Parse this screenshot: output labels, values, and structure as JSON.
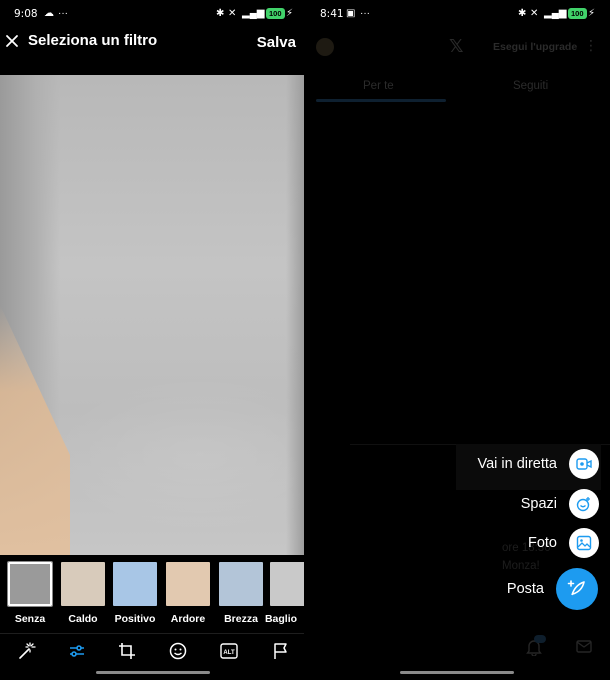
{
  "left": {
    "status": {
      "time": "9:08",
      "battery": "100"
    },
    "header": {
      "title": "Seleziona un filtro",
      "save_label": "Salva"
    },
    "filters": [
      {
        "label": "Senza",
        "selected": true,
        "color": "#9a9a9a"
      },
      {
        "label": "Caldo",
        "selected": false,
        "color": "#d8cbbb"
      },
      {
        "label": "Positivo",
        "selected": false,
        "color": "#a8c6e6"
      },
      {
        "label": "Ardore",
        "selected": false,
        "color": "#e2c9b0"
      },
      {
        "label": "Brezza",
        "selected": false,
        "color": "#b3c5d8"
      },
      {
        "label": "Baglio",
        "selected": false,
        "color": "#c9c9c9"
      }
    ],
    "toolbar": [
      {
        "icon": "magic-wand-icon"
      },
      {
        "icon": "sliders-icon",
        "active": true,
        "color": "#1d9bf0"
      },
      {
        "icon": "crop-icon"
      },
      {
        "icon": "sticker-icon"
      },
      {
        "icon": "alt-text-icon",
        "text": "ALT"
      },
      {
        "icon": "flag-icon"
      }
    ]
  },
  "right": {
    "status": {
      "time": "8:41",
      "battery": "100"
    },
    "header": {
      "upgrade_label": "Esegui l'upgrade"
    },
    "tabs": [
      {
        "label": "Per te",
        "active": true
      },
      {
        "label": "Seguiti",
        "active": false
      }
    ],
    "speed_dial": [
      {
        "label": "Vai in diretta",
        "icon": "live-video-icon"
      },
      {
        "label": "Spazi",
        "icon": "spaces-icon"
      },
      {
        "label": "Foto",
        "icon": "photo-icon"
      },
      {
        "label": "Posta",
        "icon": "compose-post-icon",
        "primary": true,
        "color": "#1d9bf0"
      }
    ],
    "background_text": {
      "line1": "ore 18:30",
      "line2": "Monza!"
    }
  }
}
